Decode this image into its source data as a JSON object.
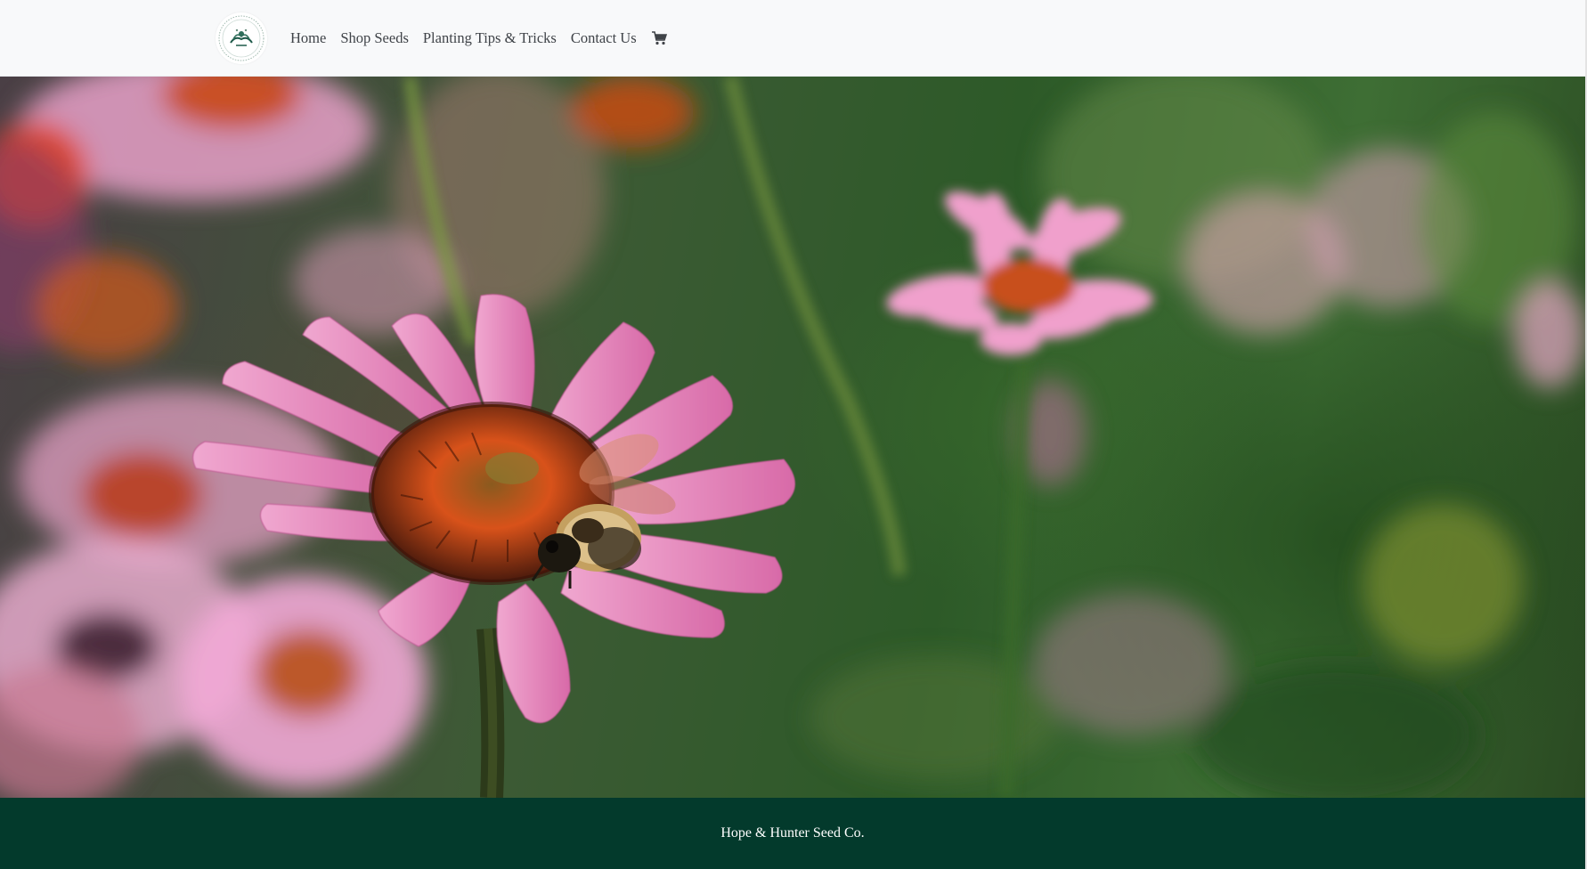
{
  "navbar": {
    "logo_icon": "hope-hunter-crest-logo",
    "links": [
      {
        "label": "Home"
      },
      {
        "label": "Shop Seeds"
      },
      {
        "label": "Planting Tips & Tricks"
      },
      {
        "label": "Contact Us"
      }
    ],
    "cart_icon": "shopping-cart-icon"
  },
  "hero": {
    "image": "coneflower-with-bumblebee-photo"
  },
  "footer": {
    "text": "Hope & Hunter Seed Co."
  },
  "colors": {
    "navbar_bg": "#f8f9fa",
    "footer_bg": "#033a2c",
    "nav_text": "#3f4348"
  }
}
